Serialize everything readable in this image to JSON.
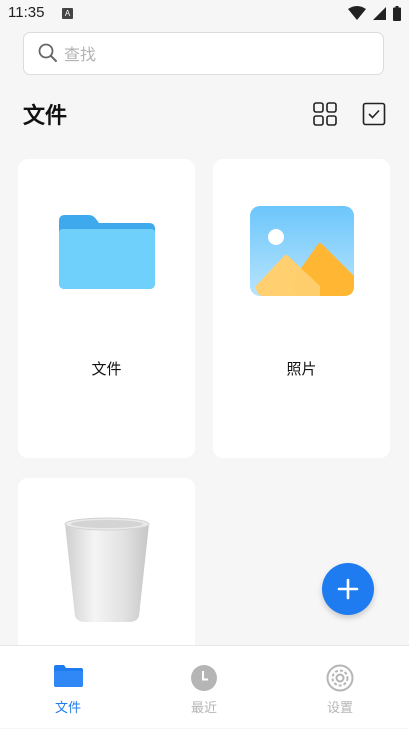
{
  "status_bar": {
    "time": "11:35",
    "notification_letter": "A"
  },
  "search": {
    "placeholder": "查找",
    "value": ""
  },
  "header": {
    "title": "文件"
  },
  "cards": [
    {
      "label": "文件",
      "icon": "folder-icon"
    },
    {
      "label": "照片",
      "icon": "photo-icon"
    },
    {
      "label": "",
      "icon": "trash-icon"
    }
  ],
  "bottom_nav": {
    "items": [
      {
        "label": "文件",
        "icon": "folder-icon",
        "active": true
      },
      {
        "label": "最近",
        "icon": "clock-icon",
        "active": false
      },
      {
        "label": "设置",
        "icon": "gear-icon",
        "active": false
      }
    ]
  },
  "colors": {
    "accent": "#1e7cf0",
    "folder": "#5bc1f7",
    "inactive": "#b5b5b5"
  }
}
